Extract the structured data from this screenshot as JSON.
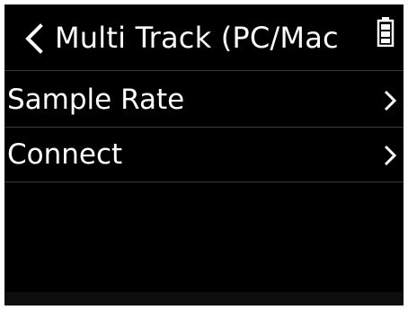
{
  "header": {
    "title": "Multi Track (PC/Mac",
    "back_icon": "chevron-left-icon",
    "battery_icon": "battery-icon"
  },
  "menu": {
    "items": [
      {
        "label": "Sample Rate",
        "icon": "chevron-right-icon"
      },
      {
        "label": "Connect",
        "icon": "chevron-right-icon"
      }
    ]
  },
  "colors": {
    "background": "#000000",
    "text": "#ffffff",
    "divider": "#3a3a3a"
  }
}
